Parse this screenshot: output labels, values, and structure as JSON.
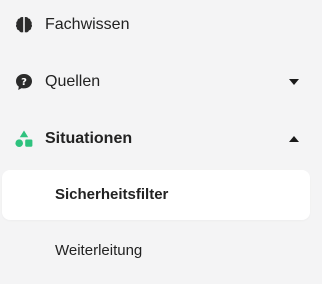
{
  "sidebar": {
    "items": [
      {
        "label": "Fachwissen",
        "icon": "brain-icon",
        "expanded": null
      },
      {
        "label": "Quellen",
        "icon": "question-bubble-icon",
        "expanded": false,
        "chevron": "caret-down-icon"
      },
      {
        "label": "Situationen",
        "icon": "shapes-icon",
        "expanded": true,
        "active": true,
        "chevron": "caret-up-icon",
        "icon_color": "#2ec27e",
        "children": [
          {
            "label": "Sicherheitsfilter",
            "selected": true
          },
          {
            "label": "Weiterleitung",
            "selected": false
          }
        ]
      }
    ]
  },
  "colors": {
    "background": "#f4f4f5",
    "selected_background": "#ffffff",
    "accent_green": "#2ec27e",
    "text": "#222222"
  }
}
